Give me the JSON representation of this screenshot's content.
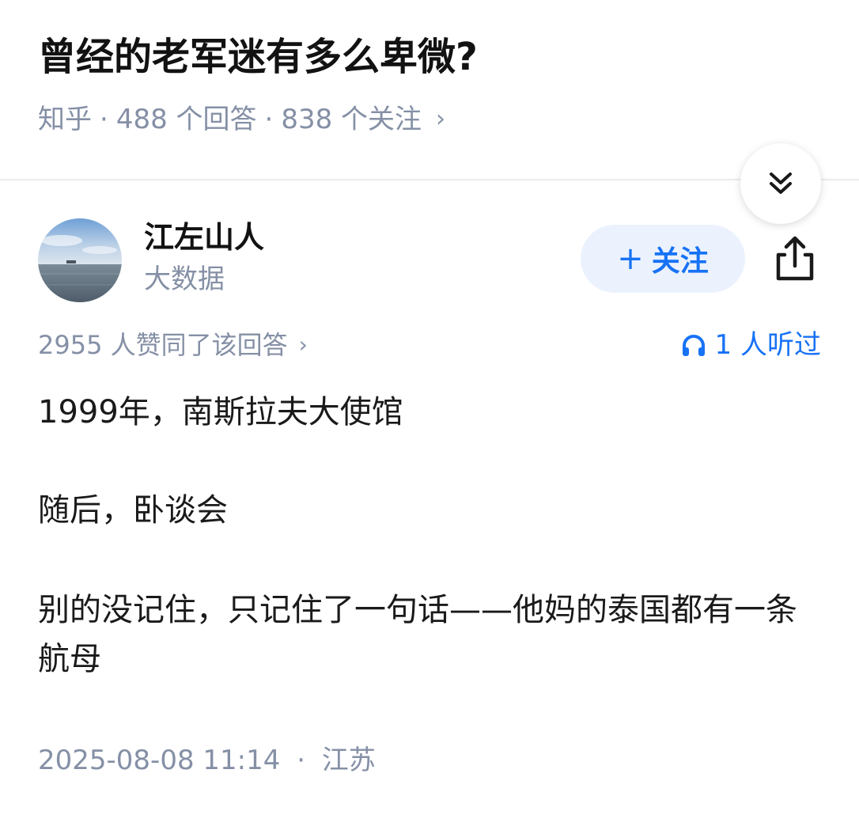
{
  "question": {
    "title": "曾经的老军迷有多么卑微?",
    "source": "知乎",
    "answers": "488 个回答",
    "followers": "838 个关注",
    "separator": "·",
    "chevron": "›"
  },
  "author": {
    "name": "江左山人",
    "tag": "大数据",
    "follow_label": "关注",
    "follow_plus": "+"
  },
  "answer": {
    "upvotes": "2955 人赞同了该回答",
    "upvote_chevron": "›",
    "listened": "1 人听过",
    "paragraphs": [
      "1999年，南斯拉夫大使馆",
      "随后，卧谈会",
      "别的没记住，只记住了一句话——他妈的泰国都有一条航母"
    ],
    "date": "2025-08-08 11:14",
    "location": "江苏",
    "separator": "·"
  },
  "icons": {
    "collapse": "double-chevron-down-icon",
    "share": "share-icon",
    "headphones": "headphones-icon"
  },
  "colors": {
    "accent": "#1772f6",
    "follow_bg": "#ebf2fd",
    "muted": "#8590a6",
    "text": "#1a1a1a"
  }
}
